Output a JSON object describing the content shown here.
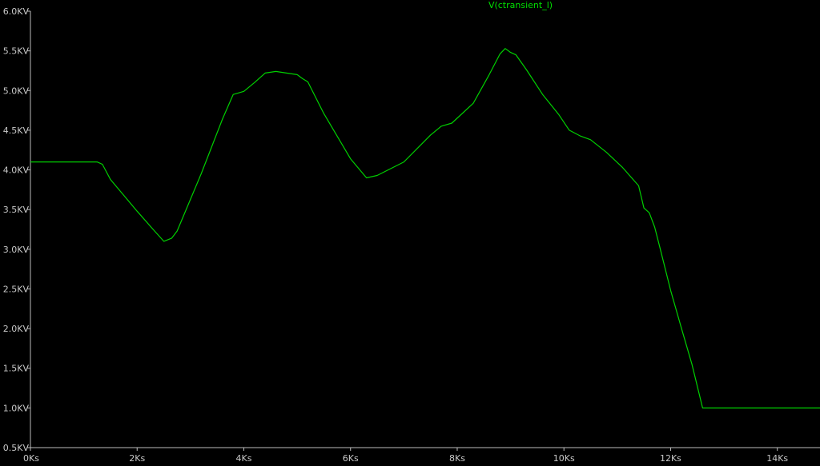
{
  "chart_data": {
    "type": "line",
    "title": "V(ctransient_l)",
    "xlabel": "",
    "ylabel": "",
    "xlim": [
      0,
      14800
    ],
    "ylim": [
      500,
      6000
    ],
    "grid": false,
    "legend": "none",
    "x_ticks": [
      {
        "value": 0,
        "label": "0Ks"
      },
      {
        "value": 2000,
        "label": "2Ks"
      },
      {
        "value": 4000,
        "label": "4Ks"
      },
      {
        "value": 6000,
        "label": "6Ks"
      },
      {
        "value": 8000,
        "label": "8Ks"
      },
      {
        "value": 10000,
        "label": "10Ks"
      },
      {
        "value": 12000,
        "label": "12Ks"
      },
      {
        "value": 14000,
        "label": "14Ks"
      }
    ],
    "y_ticks": [
      {
        "value": 500,
        "label": "0.5KV"
      },
      {
        "value": 1000,
        "label": "1.0KV"
      },
      {
        "value": 1500,
        "label": "1.5KV"
      },
      {
        "value": 2000,
        "label": "2.0KV"
      },
      {
        "value": 2500,
        "label": "2.5KV"
      },
      {
        "value": 3000,
        "label": "3.0KV"
      },
      {
        "value": 3500,
        "label": "3.5KV"
      },
      {
        "value": 4000,
        "label": "4.0KV"
      },
      {
        "value": 4500,
        "label": "4.5KV"
      },
      {
        "value": 5000,
        "label": "5.0KV"
      },
      {
        "value": 5500,
        "label": "5.5KV"
      },
      {
        "value": 6000,
        "label": "6.0KV"
      }
    ],
    "series": [
      {
        "name": "V(ctransient_l)",
        "color": "#00d000",
        "x": [
          0,
          1000,
          1250,
          1350,
          1500,
          2000,
          2300,
          2500,
          2650,
          2750,
          3200,
          3600,
          3800,
          4000,
          4200,
          4400,
          4600,
          5000,
          5100,
          5200,
          5500,
          6000,
          6300,
          6500,
          7000,
          7500,
          7700,
          7900,
          8300,
          8600,
          8800,
          8900,
          9000,
          9100,
          9300,
          9600,
          9900,
          10100,
          10300,
          10500,
          10800,
          11100,
          11400,
          11500,
          11600,
          11700,
          11800,
          12000,
          12200,
          12400,
          12600,
          14800
        ],
        "y": [
          4100,
          4100,
          4100,
          4070,
          3880,
          3480,
          3250,
          3100,
          3140,
          3230,
          3950,
          4640,
          4950,
          4990,
          5100,
          5220,
          5240,
          5200,
          5150,
          5110,
          4710,
          4140,
          3900,
          3930,
          4100,
          4440,
          4550,
          4590,
          4840,
          5200,
          5460,
          5530,
          5480,
          5450,
          5260,
          4950,
          4700,
          4500,
          4430,
          4380,
          4220,
          4030,
          3800,
          3520,
          3460,
          3280,
          3020,
          2480,
          2010,
          1550,
          1000,
          1000
        ]
      }
    ]
  }
}
